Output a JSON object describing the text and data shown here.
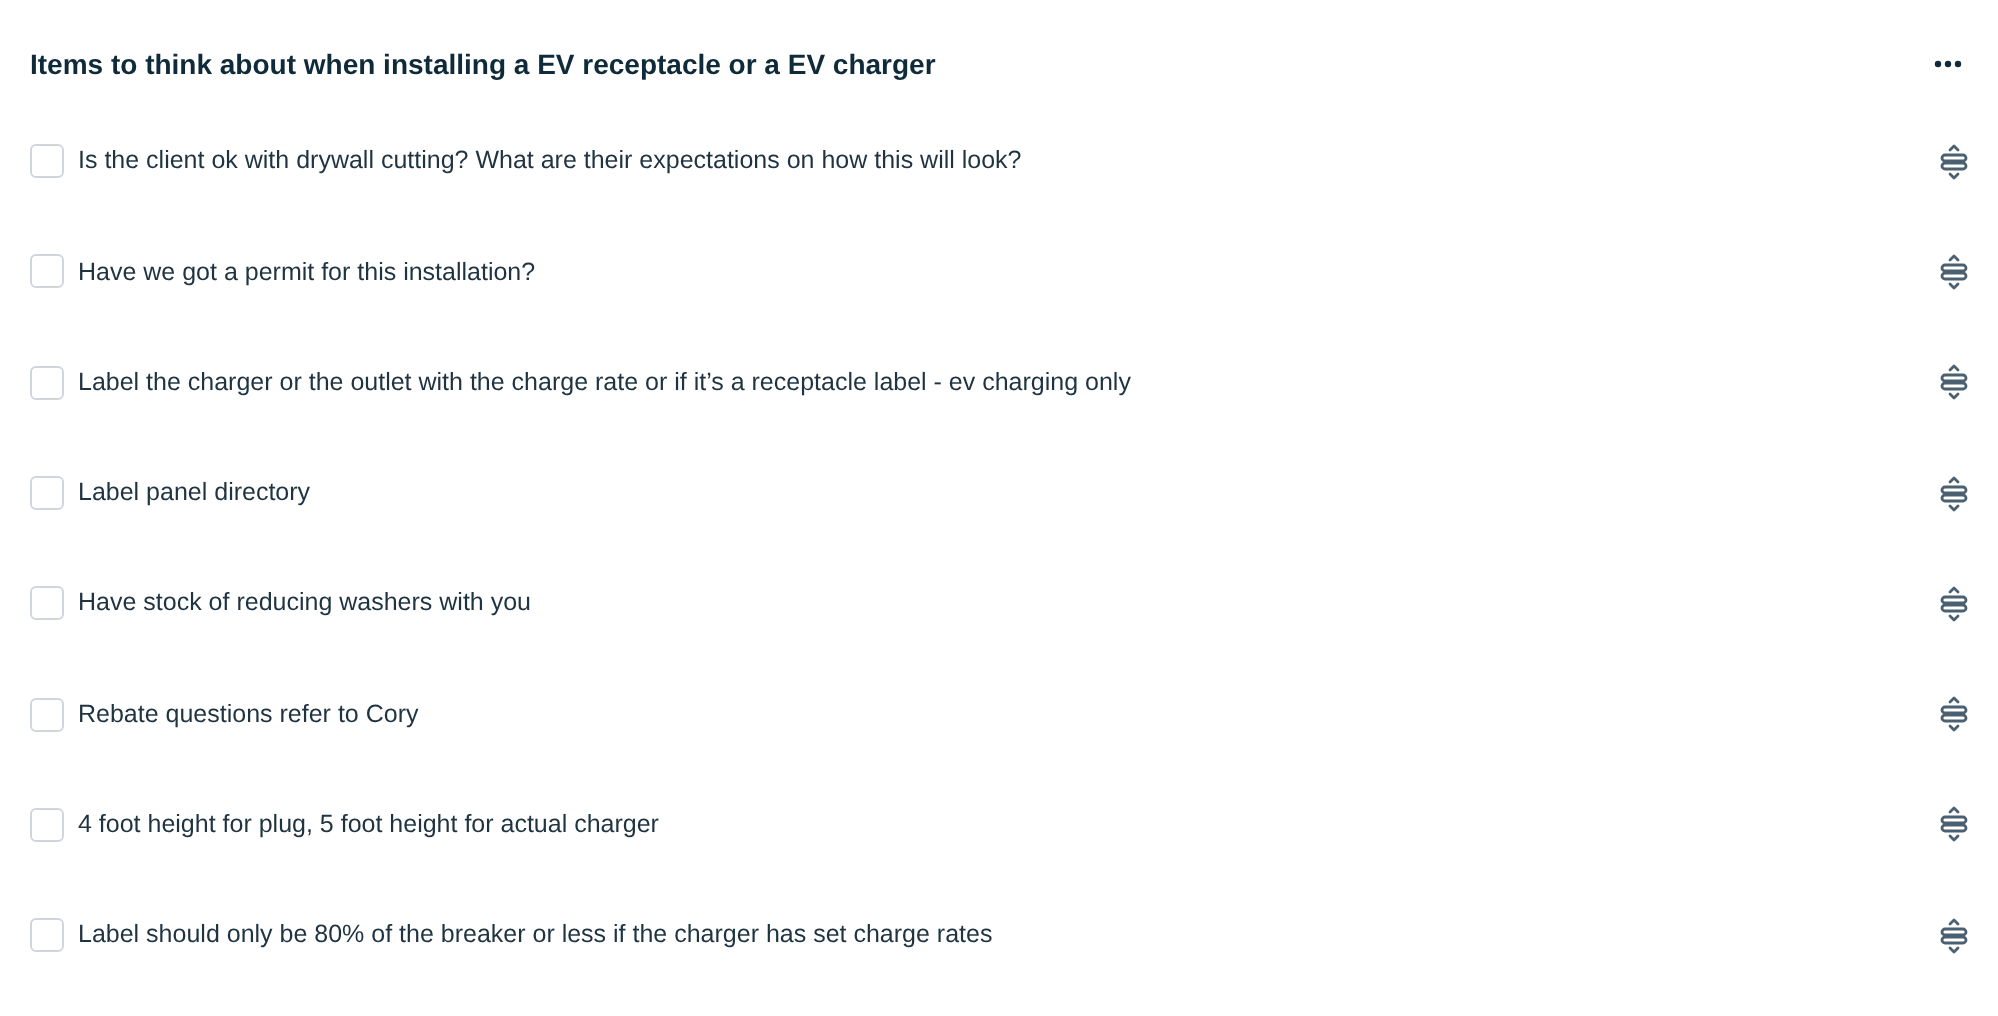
{
  "title": "Items to think about when installing a EV receptacle or a EV charger",
  "items": [
    {
      "label": "Is the client ok with drywall cutting? What are their expectations on how this will look?",
      "checked": false
    },
    {
      "label": "Have we got a permit for this installation?",
      "checked": false
    },
    {
      "label": "Label the charger or the outlet with the charge rate or if it’s a receptacle label - ev charging only",
      "checked": false
    },
    {
      "label": "Label panel directory",
      "checked": false
    },
    {
      "label": "Have stock of reducing washers with you",
      "checked": false
    },
    {
      "label": "Rebate questions refer to Cory",
      "checked": false
    },
    {
      "label": "4 foot height for plug, 5 foot height for actual charger",
      "checked": false
    },
    {
      "label": "Label should only be 80% of the breaker or less if the charger has set charge rates",
      "checked": false
    }
  ]
}
